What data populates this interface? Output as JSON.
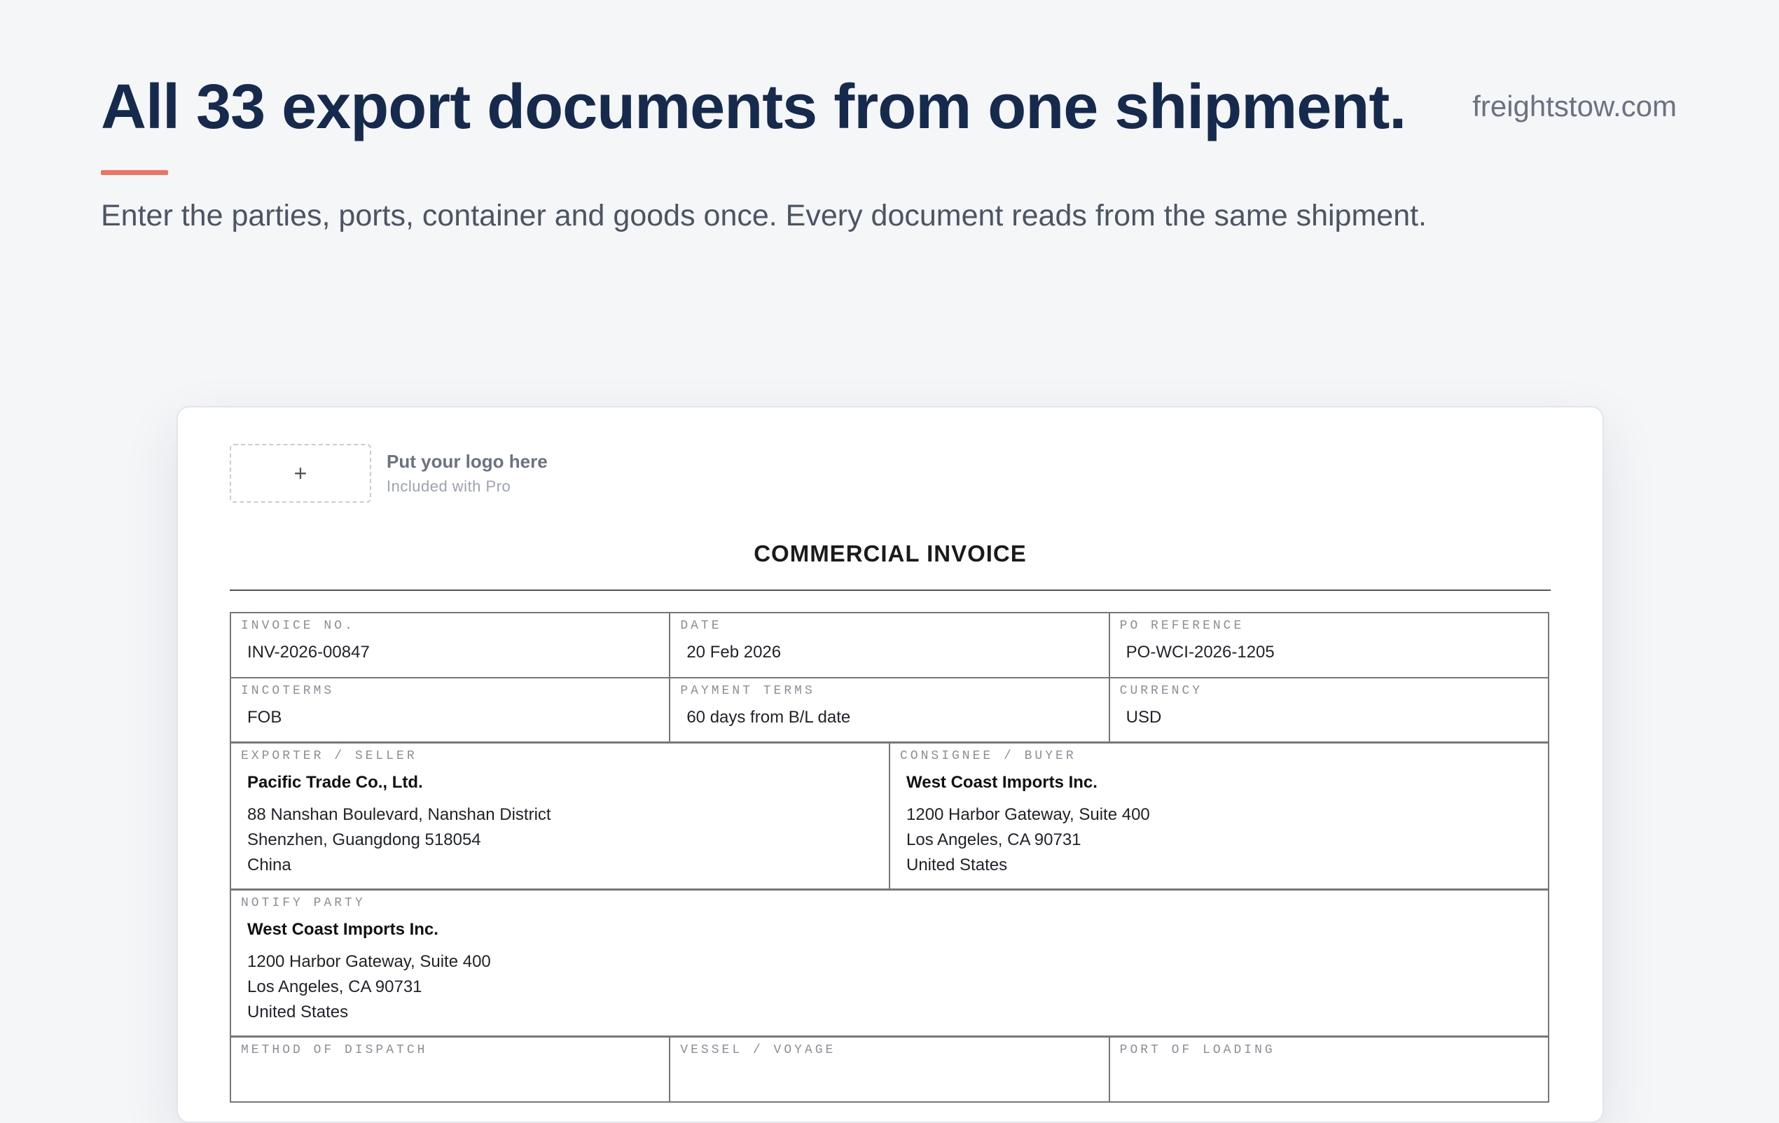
{
  "header": {
    "headline": "All 33 export documents from one shipment.",
    "site": "freightstow.com",
    "subhead": "Enter the parties, ports, container and goods once. Every document reads from the same shipment.",
    "accent_color": "#ee7461"
  },
  "logo_slot": {
    "plus_icon": "+",
    "title": "Put your logo here",
    "note": "Included with Pro"
  },
  "document": {
    "title": "COMMERCIAL INVOICE",
    "row1": [
      {
        "label": "INVOICE NO.",
        "value": "INV-2026-00847"
      },
      {
        "label": "DATE",
        "value": "20 Feb 2026"
      },
      {
        "label": "PO REFERENCE",
        "value": "PO-WCI-2026-1205"
      }
    ],
    "row2": [
      {
        "label": "INCOTERMS",
        "value": "FOB"
      },
      {
        "label": "PAYMENT TERMS",
        "value": "60 days from B/L date"
      },
      {
        "label": "CURRENCY",
        "value": "USD"
      }
    ],
    "exporter": {
      "label": "EXPORTER / SELLER",
      "name": "Pacific Trade Co., Ltd.",
      "lines": [
        "88 Nanshan Boulevard, Nanshan District",
        "Shenzhen, Guangdong 518054",
        "China"
      ]
    },
    "consignee": {
      "label": "CONSIGNEE / BUYER",
      "name": "West Coast Imports Inc.",
      "lines": [
        "1200 Harbor Gateway, Suite 400",
        "Los Angeles, CA 90731",
        "United States"
      ]
    },
    "notify": {
      "label": "NOTIFY PARTY",
      "name": "West Coast Imports Inc.",
      "lines": [
        "1200 Harbor Gateway, Suite 400",
        "Los Angeles, CA 90731",
        "United States"
      ]
    },
    "row_dispatch": [
      {
        "label": "METHOD OF DISPATCH"
      },
      {
        "label": "VESSEL / VOYAGE"
      },
      {
        "label": "PORT OF LOADING"
      }
    ]
  }
}
